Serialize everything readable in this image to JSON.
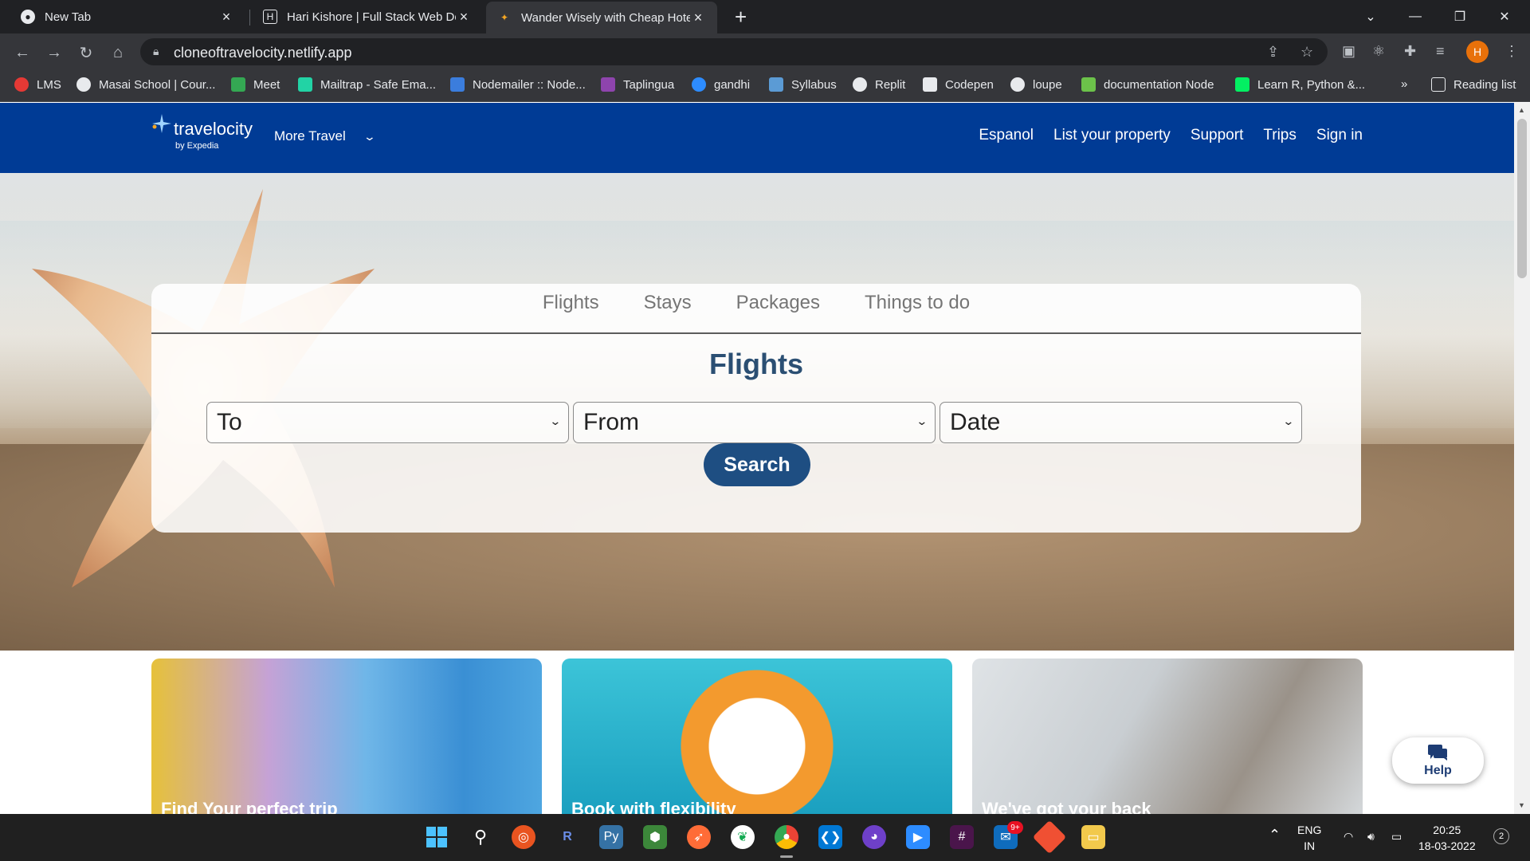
{
  "browser": {
    "tabs": [
      {
        "label": "New Tab",
        "active": false
      },
      {
        "label": "Hari Kishore | Full Stack Web Dev",
        "active": false
      },
      {
        "label": "Wander Wisely with Cheap Hotel",
        "active": true
      }
    ],
    "new_tab_symbol": "+",
    "url": "cloneoftravelocity.netlify.app",
    "profile_initial": "H",
    "reading_list_label": "Reading list",
    "bookmarks_overflow": "»",
    "bookmarks": [
      {
        "label": "LMS",
        "color": "#e53935"
      },
      {
        "label": "Masai School | Cour...",
        "color": "#e8eaed"
      },
      {
        "label": "Meet",
        "color": "#34a853"
      },
      {
        "label": "Mailtrap - Safe Ema...",
        "color": "#22d3a5"
      },
      {
        "label": "Nodemailer :: Node...",
        "color": "#3b7ddd"
      },
      {
        "label": "Taplingua",
        "color": "#8e44ad"
      },
      {
        "label": "gandhi",
        "color": "#2d8cff"
      },
      {
        "label": "Syllabus",
        "color": "#5b9bd5"
      },
      {
        "label": "Replit",
        "color": "#e8eaed"
      },
      {
        "label": "Codepen",
        "color": "#e8eaed"
      },
      {
        "label": "loupe",
        "color": "#e8eaed"
      },
      {
        "label": "documentation Node",
        "color": "#6cc24a"
      },
      {
        "label": "Learn R, Python &...",
        "color": "#03ef62"
      }
    ]
  },
  "site": {
    "logo_name": "travelocity",
    "logo_sub": "by Expedia",
    "more_travel": "More Travel",
    "nav": [
      "Espanol",
      "List your property",
      "Support",
      "Trips",
      "Sign in"
    ],
    "brand_color": "#003b95"
  },
  "search": {
    "modes": [
      "Flights",
      "Stays",
      "Packages",
      "Things to do"
    ],
    "title": "Flights",
    "selects": [
      {
        "value": "To"
      },
      {
        "value": "From"
      },
      {
        "value": "Date"
      }
    ],
    "button": "Search"
  },
  "promo_cards": [
    {
      "title": "Find Your perfect trip"
    },
    {
      "title": "Book with flexibility"
    },
    {
      "title": "We've got your back"
    }
  ],
  "help": {
    "label": "Help"
  },
  "taskbar": {
    "language": "ENG",
    "region": "IN",
    "time": "20:25",
    "date": "18-03-2022",
    "mail_badge": "9+",
    "notification_count": "2"
  }
}
